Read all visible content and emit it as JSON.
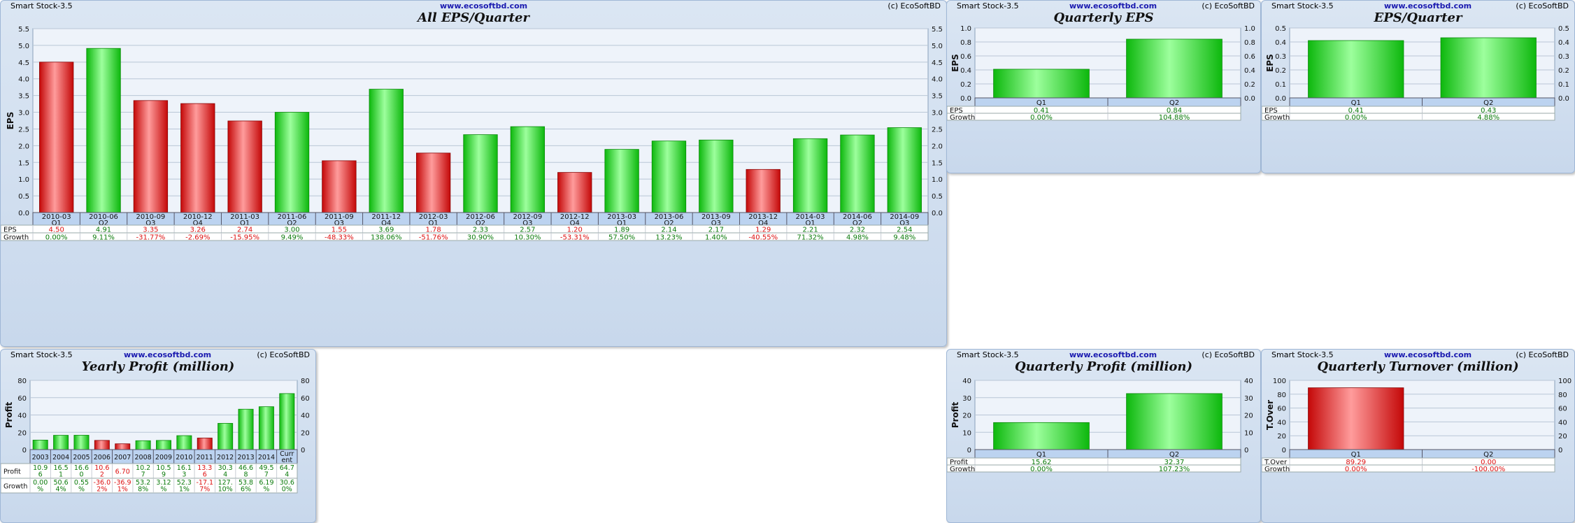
{
  "app_name": "Smart Stock-3.5",
  "website": "www.ecosoftbd.com",
  "copyright": "(c) EcoSoftBD",
  "colors": {
    "up": "#14d814",
    "down": "#dd1010",
    "plot_bg": "#eef3fa",
    "grid": "#b9c6d6",
    "good_text": "#0a7a0a",
    "bad_text": "#dd1010"
  },
  "chart_data": [
    {
      "id": "all-eps",
      "type": "bar",
      "title": "All EPS/Quarter",
      "ylabel": "EPS",
      "ylim": [
        0,
        5.5
      ],
      "yticks": [
        "0.0",
        "0.5",
        "1.0",
        "1.5",
        "2.0",
        "2.5",
        "3.0",
        "3.5",
        "4.0",
        "4.5",
        "5.0",
        "5.5"
      ],
      "categories": [
        [
          "2010-03",
          "Q1"
        ],
        [
          "2010-06",
          "Q2"
        ],
        [
          "2010-09",
          "Q3"
        ],
        [
          "2010-12",
          "Q4"
        ],
        [
          "2011-03",
          "Q1"
        ],
        [
          "2011-06",
          "Q2"
        ],
        [
          "2011-09",
          "Q3"
        ],
        [
          "2011-12",
          "Q4"
        ],
        [
          "2012-03",
          "Q1"
        ],
        [
          "2012-06",
          "Q2"
        ],
        [
          "2012-09",
          "Q3"
        ],
        [
          "2012-12",
          "Q4"
        ],
        [
          "2013-03",
          "Q1"
        ],
        [
          "2013-06",
          "Q2"
        ],
        [
          "2013-09",
          "Q3"
        ],
        [
          "2013-12",
          "Q4"
        ],
        [
          "2014-03",
          "Q1"
        ],
        [
          "2014-06",
          "Q2"
        ],
        [
          "2014-09",
          "Q3"
        ]
      ],
      "values": [
        4.5,
        4.91,
        3.35,
        3.26,
        2.74,
        3.0,
        1.55,
        3.69,
        1.78,
        2.33,
        2.57,
        1.2,
        1.89,
        2.14,
        2.17,
        1.29,
        2.21,
        2.32,
        2.54
      ],
      "bar_colors": [
        "down",
        "up",
        "down",
        "down",
        "down",
        "up",
        "down",
        "up",
        "down",
        "up",
        "up",
        "down",
        "up",
        "up",
        "up",
        "down",
        "up",
        "up",
        "up"
      ],
      "rows": [
        {
          "label": "EPS",
          "cells": [
            "4.50",
            "4.91",
            "3.35",
            "3.26",
            "2.74",
            "3.00",
            "1.55",
            "3.69",
            "1.78",
            "2.33",
            "2.57",
            "1.20",
            "1.89",
            "2.14",
            "2.17",
            "1.29",
            "2.21",
            "2.32",
            "2.54"
          ]
        },
        {
          "label": "Growth",
          "cells": [
            "0.00%",
            "9.11%",
            "-31.77%",
            "-2.69%",
            "-15.95%",
            "9.49%",
            "-48.33%",
            "138.06%",
            "-51.76%",
            "30.90%",
            "10.30%",
            "-53.31%",
            "57.50%",
            "13.23%",
            "1.40%",
            "-40.55%",
            "71.32%",
            "4.98%",
            "9.48%"
          ]
        }
      ],
      "row_colors": [
        [
          "down",
          "up",
          "down",
          "down",
          "down",
          "up",
          "down",
          "up",
          "down",
          "up",
          "up",
          "down",
          "up",
          "up",
          "up",
          "down",
          "up",
          "up",
          "up"
        ],
        [
          "up",
          "up",
          "down",
          "down",
          "down",
          "up",
          "down",
          "up",
          "down",
          "up",
          "up",
          "down",
          "up",
          "up",
          "up",
          "down",
          "up",
          "up",
          "up"
        ]
      ]
    },
    {
      "id": "quarterly-eps",
      "type": "bar",
      "title": "Quarterly EPS",
      "ylabel": "EPS",
      "ylim": [
        0,
        1.0
      ],
      "yticks": [
        "0.0",
        "0.2",
        "0.4",
        "0.6",
        "0.8",
        "1.0"
      ],
      "categories": [
        [
          "Q1"
        ],
        [
          "Q2"
        ]
      ],
      "values": [
        0.41,
        0.84
      ],
      "bar_colors": [
        "up",
        "up"
      ],
      "rows": [
        {
          "label": "EPS",
          "cells": [
            "0.41",
            "0.84"
          ]
        },
        {
          "label": "Growth",
          "cells": [
            "0.00%",
            "104.88%"
          ]
        }
      ],
      "row_colors": [
        [
          "up",
          "up"
        ],
        [
          "up",
          "up"
        ]
      ]
    },
    {
      "id": "eps-quarter",
      "type": "bar",
      "title": "EPS/Quarter",
      "ylabel": "EPS",
      "ylim": [
        0,
        0.5
      ],
      "yticks": [
        "0.0",
        "0.1",
        "0.2",
        "0.3",
        "0.4",
        "0.5"
      ],
      "categories": [
        [
          "Q1"
        ],
        [
          "Q2"
        ]
      ],
      "values": [
        0.41,
        0.43
      ],
      "bar_colors": [
        "up",
        "up"
      ],
      "rows": [
        {
          "label": "EPS",
          "cells": [
            "0.41",
            "0.43"
          ]
        },
        {
          "label": "Growth",
          "cells": [
            "0.00%",
            "4.88%"
          ]
        }
      ],
      "row_colors": [
        [
          "up",
          "up"
        ],
        [
          "up",
          "up"
        ]
      ]
    },
    {
      "id": "yearly-profit",
      "type": "bar",
      "title": "Yearly Profit (million)",
      "ylabel": "Profit",
      "ylim": [
        0,
        80
      ],
      "yticks": [
        "0",
        "20",
        "40",
        "60",
        "80"
      ],
      "categories": [
        [
          "2003"
        ],
        [
          "2004"
        ],
        [
          "2005"
        ],
        [
          "2006"
        ],
        [
          "2007"
        ],
        [
          "2008"
        ],
        [
          "2009"
        ],
        [
          "2010"
        ],
        [
          "2011"
        ],
        [
          "2012"
        ],
        [
          "2013"
        ],
        [
          "2014"
        ],
        [
          "Curr",
          "ent"
        ]
      ],
      "values": [
        10.96,
        16.51,
        16.6,
        10.62,
        6.7,
        10.27,
        10.59,
        16.13,
        13.36,
        30.34,
        46.68,
        49.57,
        64.74
      ],
      "bar_colors": [
        "up",
        "up",
        "up",
        "down",
        "down",
        "up",
        "up",
        "up",
        "down",
        "up",
        "up",
        "up",
        "up"
      ],
      "rows": [
        {
          "label": "Profit",
          "cells": [
            [
              "10.9",
              "6"
            ],
            [
              "16.5",
              "1"
            ],
            [
              "16.6",
              "0"
            ],
            [
              "10.6",
              "2"
            ],
            [
              "6.70"
            ],
            [
              "10.2",
              "7"
            ],
            [
              "10.5",
              "9"
            ],
            [
              "16.1",
              "3"
            ],
            [
              "13.3",
              "6"
            ],
            [
              "30.3",
              "4"
            ],
            [
              "46.6",
              "8"
            ],
            [
              "49.5",
              "7"
            ],
            [
              "64.7",
              "4"
            ]
          ]
        },
        {
          "label": "Growth",
          "cells": [
            [
              "0.00",
              "%"
            ],
            [
              "50.6",
              "4%"
            ],
            [
              "0.55",
              "%"
            ],
            [
              "-36.0",
              "2%"
            ],
            [
              "-36.9",
              "1%"
            ],
            [
              "53.2",
              "8%"
            ],
            [
              "3.12",
              "%"
            ],
            [
              "52.3",
              "1%"
            ],
            [
              "-17.1",
              "7%"
            ],
            [
              "127.",
              "10%"
            ],
            [
              "53.8",
              "6%"
            ],
            [
              "6.19",
              "%"
            ],
            [
              "30.6",
              "0%"
            ]
          ]
        }
      ],
      "row_colors": [
        [
          "up",
          "up",
          "up",
          "down",
          "down",
          "up",
          "up",
          "up",
          "down",
          "up",
          "up",
          "up",
          "up"
        ],
        [
          "up",
          "up",
          "up",
          "down",
          "down",
          "up",
          "up",
          "up",
          "down",
          "up",
          "up",
          "up",
          "up"
        ]
      ]
    },
    {
      "id": "quarterly-profit",
      "type": "bar",
      "title": "Quarterly Profit (million)",
      "ylabel": "Profit",
      "ylim": [
        0,
        40
      ],
      "yticks": [
        "0",
        "10",
        "20",
        "30",
        "40"
      ],
      "categories": [
        [
          "Q1"
        ],
        [
          "Q2"
        ]
      ],
      "values": [
        15.62,
        32.37
      ],
      "bar_colors": [
        "up",
        "up"
      ],
      "rows": [
        {
          "label": "Profit",
          "cells": [
            "15.62",
            "32.37"
          ]
        },
        {
          "label": "Growth",
          "cells": [
            "0.00%",
            "107.23%"
          ]
        }
      ],
      "row_colors": [
        [
          "up",
          "up"
        ],
        [
          "up",
          "up"
        ]
      ]
    },
    {
      "id": "quarterly-turnover",
      "type": "bar",
      "title": "Quarterly Turnover (million)",
      "ylabel": "T.Over",
      "ylim": [
        0,
        100
      ],
      "yticks": [
        "0",
        "20",
        "40",
        "60",
        "80",
        "100"
      ],
      "categories": [
        [
          "Q1"
        ],
        [
          "Q2"
        ]
      ],
      "values": [
        89.29,
        0.0
      ],
      "bar_colors": [
        "down",
        "down"
      ],
      "rows": [
        {
          "label": "T.Over",
          "cells": [
            "89.29",
            "0.00"
          ]
        },
        {
          "label": "Growth",
          "cells": [
            "0.00%",
            "-100.00%"
          ]
        }
      ],
      "row_colors": [
        [
          "down",
          "down"
        ],
        [
          "down",
          "down"
        ]
      ]
    }
  ]
}
